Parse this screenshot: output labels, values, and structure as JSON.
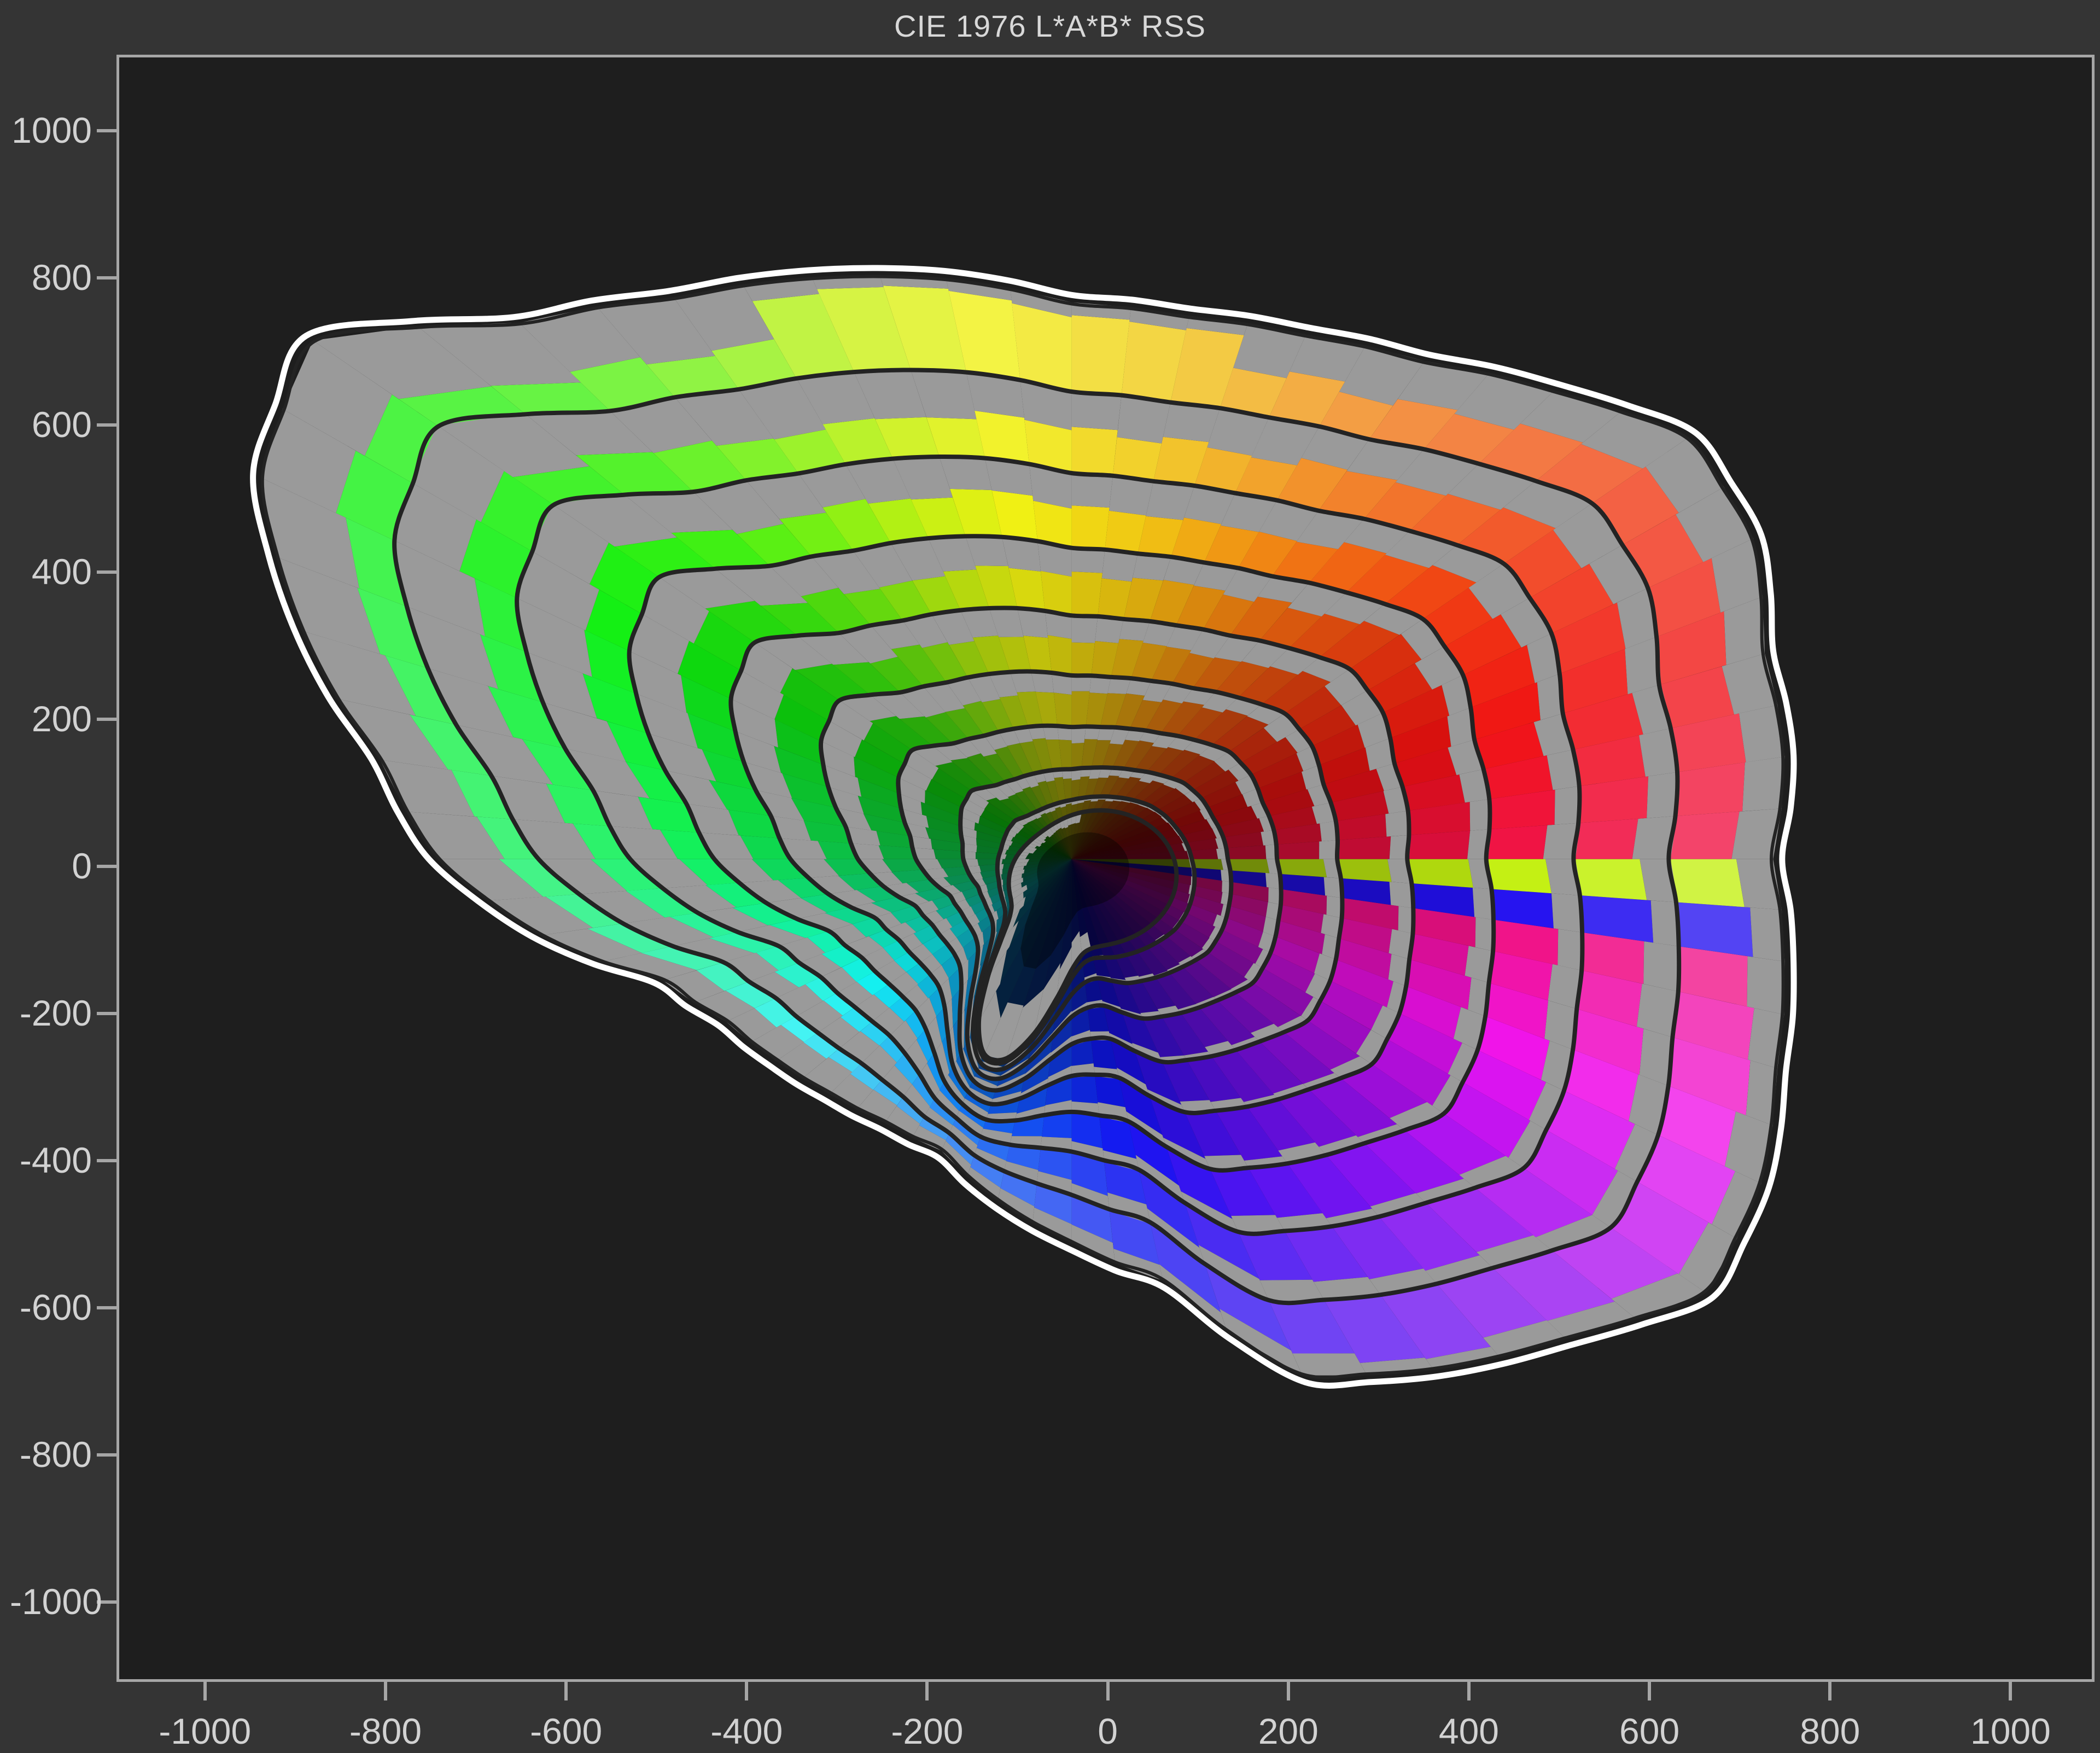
{
  "title": "CIE 1976 L*A*B* RSS",
  "window": {
    "background": "#343434",
    "plot_background": "#1e1e1e",
    "axis_color": "#a6a6a6",
    "label_color": "#d2d2d2",
    "title_color": "#d8d8d8"
  },
  "axes": {
    "x": {
      "labels": [
        "-1000",
        "-800",
        "-600",
        "-400",
        "-200",
        "0",
        "200",
        "400",
        "600",
        "800",
        "1000"
      ]
    },
    "y": {
      "labels": [
        "1000",
        "800",
        "600",
        "400",
        "200",
        "0",
        "-200",
        "-400",
        "-600",
        "-800",
        "-1000"
      ]
    }
  },
  "chart_data": {
    "type": "gamut_rings",
    "title": "CIE 1976 L*A*B* RSS",
    "xlabel": "",
    "ylabel": "",
    "x_ticks": [
      -1000,
      -800,
      -600,
      -400,
      -200,
      0,
      200,
      400,
      600,
      800,
      1000
    ],
    "y_ticks": [
      1000,
      800,
      600,
      400,
      200,
      0,
      -200,
      -400,
      -600,
      -800,
      -1000
    ],
    "x_range": [
      -1095,
      1090
    ],
    "y_range": [
      -1105,
      1100
    ],
    "grid": false,
    "legend": "none",
    "ring_levels": [
      10,
      20,
      30,
      40,
      50,
      60,
      70,
      80,
      90,
      100
    ],
    "center": [
      -40,
      10
    ],
    "angle_step_deg": 10,
    "outer_radius_by_angle": [
      775,
      800,
      815,
      870,
      890,
      830,
      780,
      757,
      748,
      755,
      800,
      840,
      880,
      950,
      1095,
      1035,
      905,
      776,
      700,
      595,
      480,
      440,
      425,
      415,
      412,
      420,
      470,
      520,
      580,
      745,
      800,
      850,
      915,
      880,
      830,
      800
    ],
    "inner_ring": {
      "base": 88,
      "amp": 38,
      "phase_deg": 48,
      "bump": 180,
      "bump_angle_deg": 252,
      "bump_width_deg": 14
    },
    "ring_scale_exponent": 1.6,
    "color_fraction_by_angle": [
      0.65,
      0.65,
      0.65,
      0.6,
      0.55,
      0.55,
      0.5,
      0.5,
      0.5,
      0.5,
      0.5,
      0.45,
      0.42,
      0.4,
      0.38,
      0.38,
      0.38,
      0.38,
      0.4,
      0.4,
      0.4,
      0.38,
      0.36,
      0.36,
      0.38,
      0.45,
      0.55,
      0.65,
      0.7,
      0.75,
      0.8,
      0.8,
      0.75,
      0.7,
      0.68,
      0.66
    ],
    "hue_by_angle": [
      345,
      352,
      360,
      365,
      372,
      380,
      388,
      398,
      408,
      415,
      422,
      432,
      450,
      465,
      475,
      482,
      490,
      495,
      500,
      510,
      520,
      532,
      542,
      552,
      562,
      572,
      582,
      590,
      600,
      612,
      622,
      632,
      645,
      657,
      675,
      692
    ],
    "band_lightness_pct": [
      19,
      24,
      29,
      35,
      40,
      45,
      51,
      56,
      61
    ],
    "band_saturation_pct": 88,
    "top_yellow_band": {
      "angle_min": 75,
      "angle_max": 115,
      "fraction": 0.87
    },
    "inner_disk": {
      "lightness_inner_pct": 8,
      "lightness_outer_pct": 13,
      "gray_rim_start": 0.78,
      "gray_rim_angle_min": 80,
      "gray_rim_angle_max": 280
    },
    "gray_color": "#9a9a9a",
    "contour_color": "#232323",
    "outline_color": "#ffffff"
  }
}
